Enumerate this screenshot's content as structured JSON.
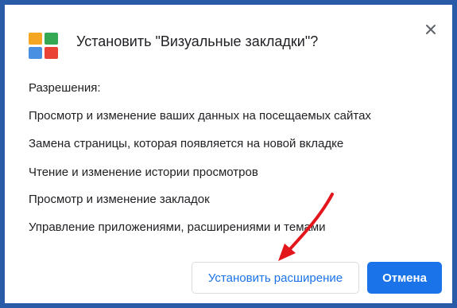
{
  "dialog": {
    "title": "Установить \"Визуальные закладки\"?",
    "close_icon": "close-icon",
    "app_icon": "visual-bookmarks-logo-icon",
    "logo_colors": [
      "#f5a623",
      "#34a853",
      "#4a90e2",
      "#ea4335"
    ],
    "permissions_heading": "Разрешения:",
    "permissions": [
      "Просмотр и изменение ваших данных на посещаемых сайтах",
      "Замена страницы, которая появляется на новой вкладке",
      "Чтение и изменение истории просмотров",
      "Просмотр и изменение закладок",
      "Управление приложениями, расширениями и темами"
    ],
    "buttons": {
      "install_label": "Установить расширение",
      "cancel_label": "Отмена"
    },
    "colors": {
      "frame": "#2a5ba8",
      "accent": "#1a73e8",
      "annotation_arrow": "#e3161c"
    },
    "annotation_icon": "red-arrow-icon"
  }
}
